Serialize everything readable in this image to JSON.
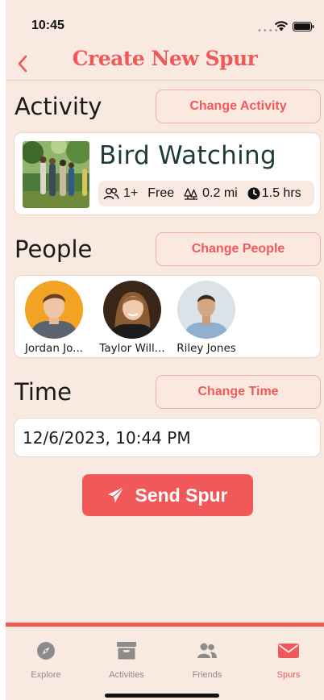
{
  "status": {
    "time": "10:45"
  },
  "header": {
    "title": "Create New Spur"
  },
  "activity": {
    "heading": "Activity",
    "change_label": "Change Activity",
    "name": "Bird Watching",
    "people": "1+",
    "price": "Free",
    "distance": "0.2 mi",
    "duration": "1.5 hrs"
  },
  "people": {
    "heading": "People",
    "change_label": "Change People",
    "items": [
      {
        "name": "Jordan Jo..."
      },
      {
        "name": "Taylor Will..."
      },
      {
        "name": "Riley Jones"
      }
    ]
  },
  "time": {
    "heading": "Time",
    "change_label": "Change Time",
    "value": "12/6/2023, 10:44 PM"
  },
  "send": {
    "label": "Send Spur"
  },
  "tabs": [
    {
      "label": "Explore"
    },
    {
      "label": "Activities"
    },
    {
      "label": "Friends"
    },
    {
      "label": "Spurs"
    }
  ],
  "colors": {
    "accent": "#f0585a",
    "background": "#f8eae0",
    "card": "#ffffff"
  }
}
